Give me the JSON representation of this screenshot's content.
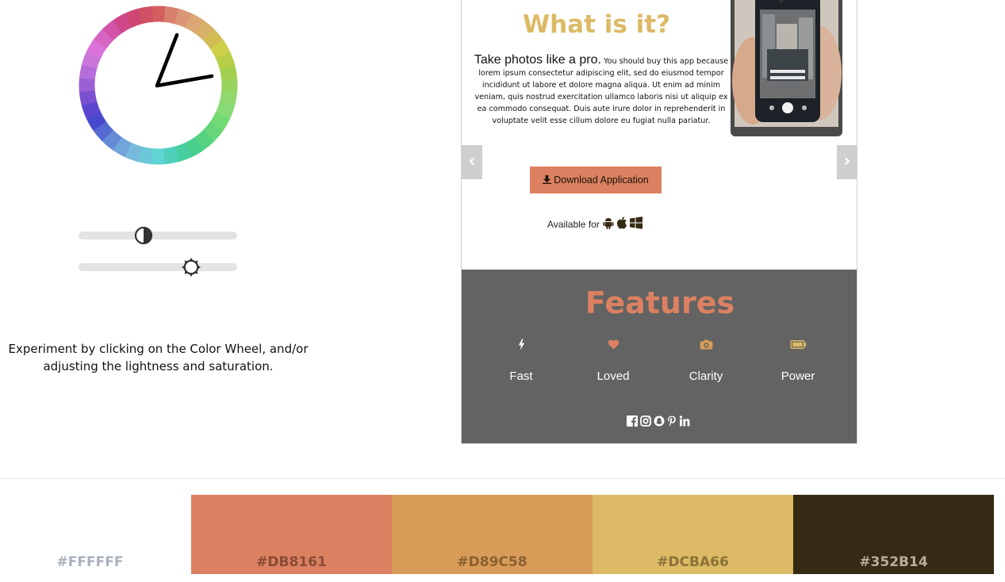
{
  "color_wheel": {
    "hue_segments": 36,
    "icon": "color-wheel-icon"
  },
  "sliders": {
    "lightness": {
      "icon": "contrast-icon",
      "value": 0.41
    },
    "saturation": {
      "icon": "brightness-icon",
      "value": 0.71
    }
  },
  "hint_text": "Experiment by clicking on the Color Wheel, and/or adjusting the lightness and saturation.",
  "preview": {
    "prev_label": "‹",
    "next_label": "›",
    "what_title": "What is it?",
    "lead": "Take photos like a pro.",
    "body": "You should buy this app because lorem ipsum consectetur adipiscing elit, sed do eiusmod tempor incididunt ut labore et dolore magna aliqua. Ut enim ad minim veniam, quis nostrud exercitation ullamco laboris nisi ut aliquip ex ea commodo consequat. Duis aute irure dolor in reprehenderit in voluptate velit esse cillum dolore eu fugiat nulla pariatur.",
    "download_label": "Download Application",
    "available_label": "Available for",
    "platform_icons": [
      "android-icon",
      "apple-icon",
      "windows-icon"
    ],
    "features_title": "Features",
    "features": [
      {
        "label": "Fast",
        "icon": "bolt-icon"
      },
      {
        "label": "Loved",
        "icon": "heart-icon"
      },
      {
        "label": "Clarity",
        "icon": "camera-icon"
      },
      {
        "label": "Power",
        "icon": "battery-icon"
      }
    ],
    "social_icons": [
      "facebook-icon",
      "instagram-icon",
      "snapchat-icon",
      "pinterest-icon",
      "linkedin-icon"
    ]
  },
  "swatches": [
    {
      "hex": "#FFFFFF",
      "text_color": "#a9b1bb"
    },
    {
      "hex": "#DB8161",
      "text_color": "#8a4a35"
    },
    {
      "hex": "#D89C58",
      "text_color": "#8a5f30"
    },
    {
      "hex": "#DCBA66",
      "text_color": "#8a7238"
    },
    {
      "hex": "#352B14",
      "text_color": "#b8ad95"
    }
  ],
  "colors": {
    "primary": "#DB8161",
    "secondary": "#D89C58",
    "accent": "#DCBA66",
    "dark": "#352B14",
    "features_bg": "#636363"
  }
}
